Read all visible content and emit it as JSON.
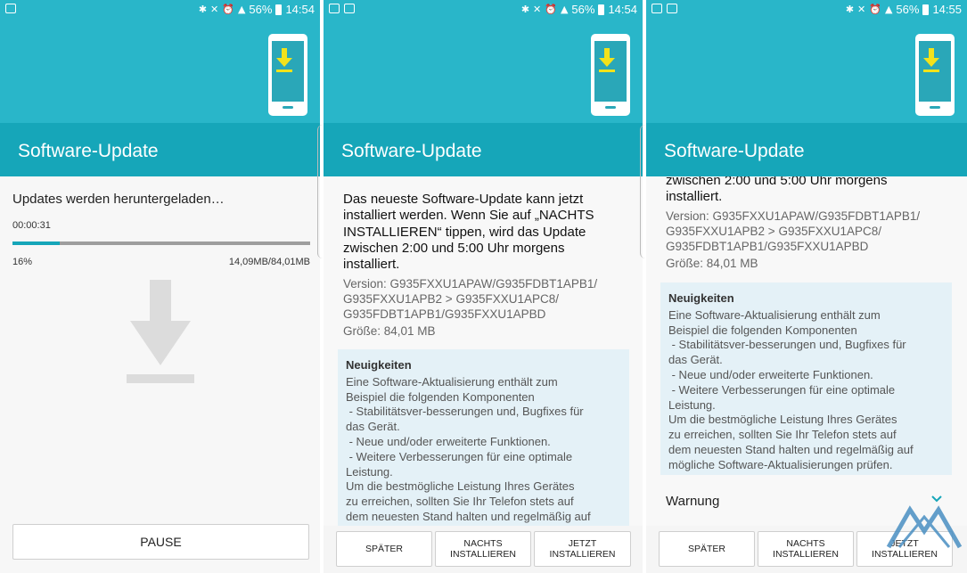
{
  "statusbar": [
    {
      "battery": "56%",
      "time": "14:54"
    },
    {
      "battery": "56%",
      "time": "14:54"
    },
    {
      "battery": "56%",
      "time": "14:55"
    }
  ],
  "header": {
    "title": "Software-Update"
  },
  "download": {
    "status": "Updates werden heruntergeladen…",
    "elapsed": "00:00:31",
    "percent_label": "16%",
    "progress": 0.16,
    "size": "14,09MB/84,01MB",
    "pause_label": "PAUSE"
  },
  "details": {
    "intro_lines": [
      "Das neueste Software-Update kann jetzt",
      "installiert werden. Wenn Sie auf „NACHTS",
      "INSTALLIEREN“ tippen, wird das Update",
      "zwischen 2:00 und 5:00 Uhr morgens",
      "installiert."
    ],
    "version_lines": [
      "Version: G935FXXU1APAW/G935FDBT1APB1/",
      "G935FXXU1APB2 > G935FXXU1APC8/",
      "G935FDBT1APB1/G935FXXU1APBD"
    ],
    "size": "Größe: 84,01 MB",
    "news_title": "Neuigkeiten",
    "news_lines": [
      "Eine Software-Aktualisierung enthält zum",
      "Beispiel die folgenden Komponenten",
      " - Stabilitätsver-besserungen und, Bugfixes für",
      "das Gerät.",
      " - Neue und/oder erweiterte Funktionen.",
      " - Weitere Verbesserungen für eine optimale",
      "Leistung.",
      "Um die bestmögliche Leistung Ihres Gerätes",
      "zu erreichen, sollten Sie Ihr Telefon stets auf",
      "dem neuesten Stand halten und regelmäßig auf",
      "mögliche Software-Aktualisierungen prüfen."
    ],
    "warning": "Warnung"
  },
  "buttons": {
    "later": "SPÄTER",
    "night_line1": "NACHTS",
    "night_line2": "INSTALLIEREN",
    "now": "JETZT INSTALLIEREN"
  },
  "colors": {
    "accent": "#16a6b9",
    "hero": "#29b6c9",
    "download_arrow": "#f2e21b"
  }
}
